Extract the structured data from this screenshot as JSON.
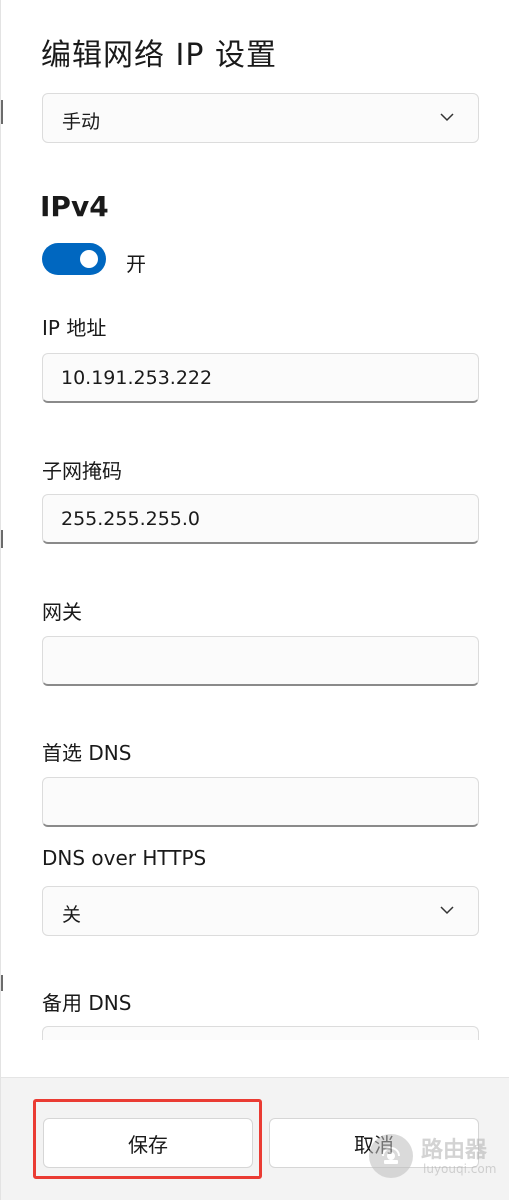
{
  "dialog": {
    "title": "编辑网络 IP 设置",
    "mode_select": {
      "value": "手动"
    }
  },
  "ipv4": {
    "heading": "IPv4",
    "toggle": {
      "state_label": "开",
      "on": true,
      "accent": "#0067c0"
    },
    "fields": {
      "ip_address": {
        "label": "IP 地址",
        "value": "10.191.253.222"
      },
      "subnet_mask": {
        "label": "子网掩码",
        "value": "255.255.255.0"
      },
      "gateway": {
        "label": "网关",
        "value": ""
      },
      "preferred_dns": {
        "label": "首选 DNS",
        "value": ""
      },
      "dns_over_https": {
        "label": "DNS over HTTPS",
        "value": "关"
      },
      "alternate_dns": {
        "label": "备用 DNS",
        "value": ""
      }
    }
  },
  "footer": {
    "save_label": "保存",
    "cancel_label": "取消"
  },
  "watermark": {
    "name": "路由器",
    "url": "luyouqi.com"
  },
  "colors": {
    "highlight": "#ea3b33",
    "footer_bg": "#f3f3f3"
  },
  "icons": {
    "dropdown": "chevron-down-icon",
    "watermark": "router-logo-icon"
  }
}
